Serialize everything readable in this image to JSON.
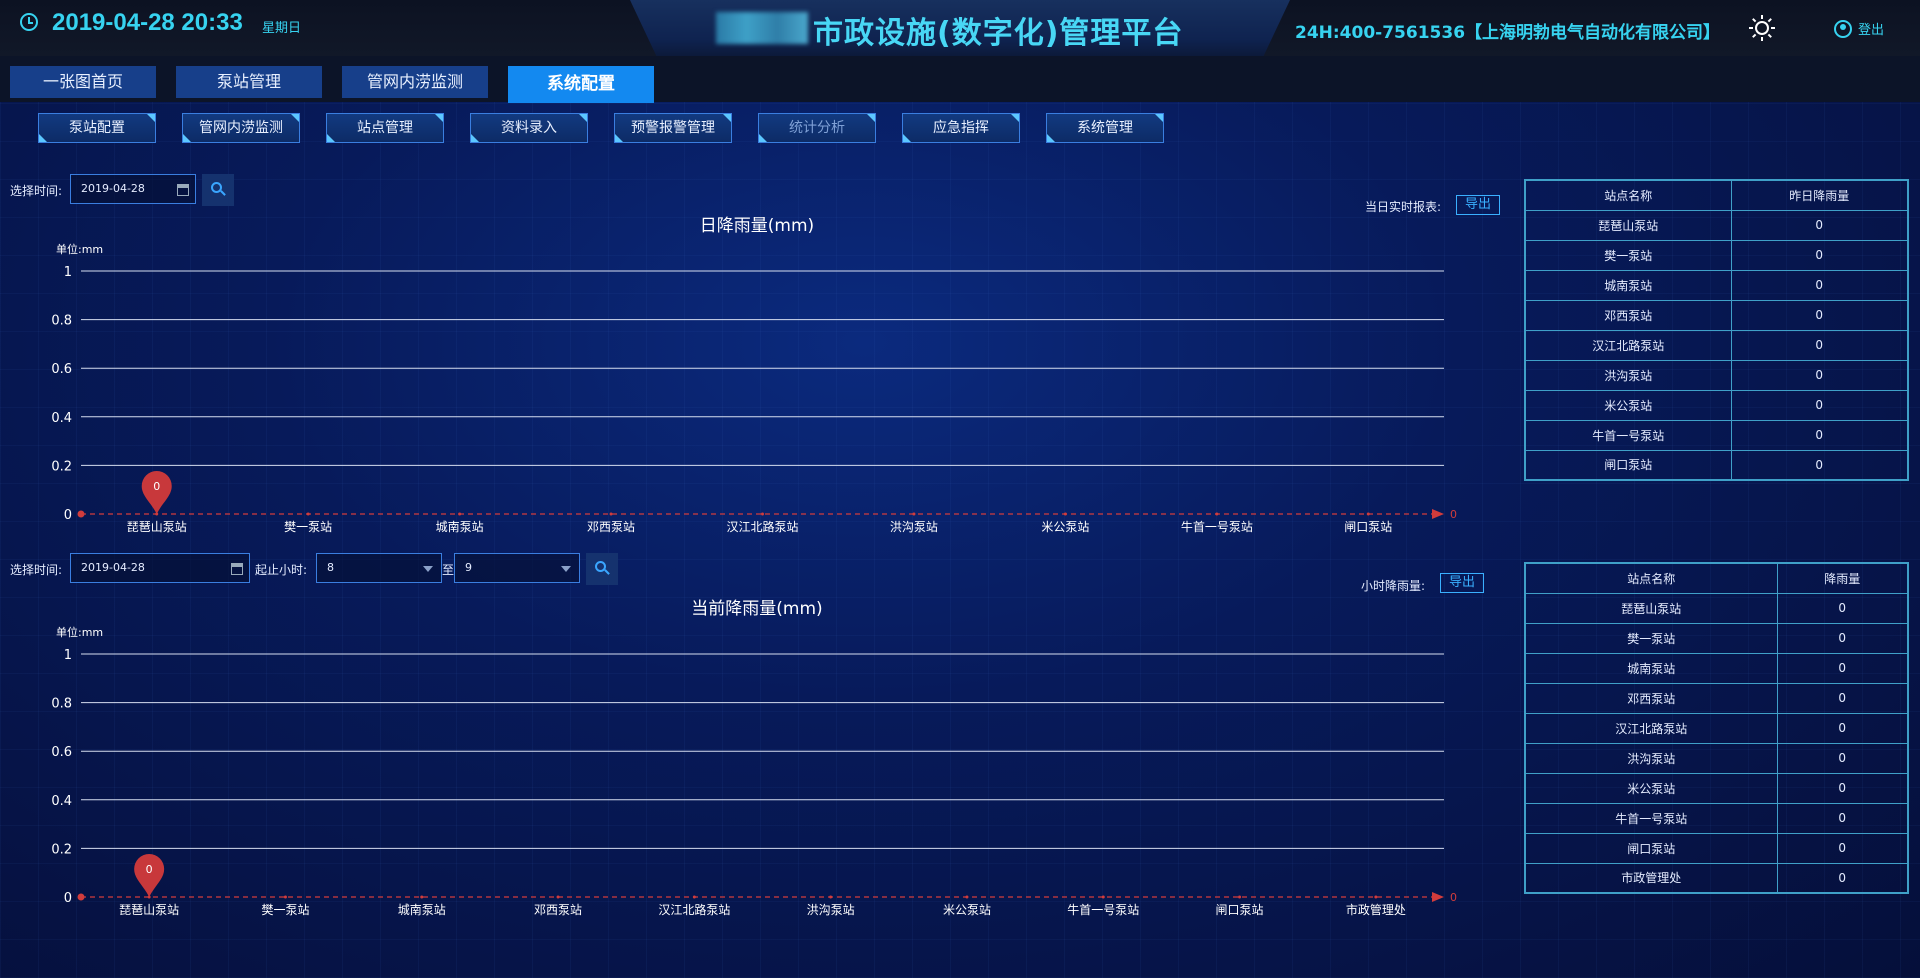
{
  "header": {
    "datetime": "2019-04-28 20:33",
    "weekday": "星期日",
    "app_title": "市政设施(数字化)管理平台",
    "hotline": "24H:400-7561536【上海明勃电气自动化有限公司】",
    "logout_label": "登出"
  },
  "main_tabs": [
    {
      "label": "一张图首页"
    },
    {
      "label": "泵站管理"
    },
    {
      "label": "管网内涝监测"
    },
    {
      "label": "系统配置",
      "active": true
    }
  ],
  "sub_tabs": [
    {
      "label": "泵站配置"
    },
    {
      "label": "管网内涝监测"
    },
    {
      "label": "站点管理"
    },
    {
      "label": "资料录入"
    },
    {
      "label": "预警报警管理"
    },
    {
      "label": "统计分析",
      "dim": true
    },
    {
      "label": "应急指挥"
    },
    {
      "label": "系统管理"
    }
  ],
  "daily": {
    "select_time_label": "选择时间:",
    "date_value": "2019-04-28",
    "report_label": "当日实时报表:",
    "export_label": "导出"
  },
  "hourly": {
    "select_time_label": "选择时间:",
    "date_value": "2019-04-28",
    "hour_label": "起止小时:",
    "hour_start": "8",
    "to_label": "至",
    "hour_end": "9",
    "report_label": "小时降雨量:",
    "export_label": "导出"
  },
  "chart_data": [
    {
      "type": "line",
      "title": "日降雨量(mm)",
      "unit_label": "单位:mm",
      "categories": [
        "琵琶山泵站",
        "樊一泵站",
        "城南泵站",
        "邓西泵站",
        "汉江北路泵站",
        "洪沟泵站",
        "米公泵站",
        "牛首一号泵站",
        "闸口泵站"
      ],
      "series": [
        {
          "values": [
            0,
            0,
            0,
            0,
            0,
            0,
            0,
            0,
            0
          ]
        }
      ],
      "ylim": [
        0,
        1
      ],
      "yticks": [
        "1",
        "0.8",
        "0.6",
        "0.4",
        "0.2",
        "0"
      ],
      "marker": {
        "category": "琵琶山泵站",
        "label": "0"
      },
      "end_label": "0",
      "grid": true
    },
    {
      "type": "line",
      "title": "当前降雨量(mm)",
      "unit_label": "单位:mm",
      "categories": [
        "琵琶山泵站",
        "樊一泵站",
        "城南泵站",
        "邓西泵站",
        "汉江北路泵站",
        "洪沟泵站",
        "米公泵站",
        "牛首一号泵站",
        "闸口泵站",
        "市政管理处"
      ],
      "series": [
        {
          "values": [
            0,
            0,
            0,
            0,
            0,
            0,
            0,
            0,
            0,
            0
          ]
        }
      ],
      "ylim": [
        0,
        1
      ],
      "yticks": [
        "1",
        "0.8",
        "0.6",
        "0.4",
        "0.2",
        "0"
      ],
      "marker": {
        "category": "琵琶山泵站",
        "label": "0"
      },
      "end_label": "0",
      "grid": true
    }
  ],
  "table_daily": {
    "headers": [
      "站点名称",
      "昨日降雨量"
    ],
    "rows": [
      [
        "琵琶山泵站",
        "0"
      ],
      [
        "樊一泵站",
        "0"
      ],
      [
        "城南泵站",
        "0"
      ],
      [
        "邓西泵站",
        "0"
      ],
      [
        "汉江北路泵站",
        "0"
      ],
      [
        "洪沟泵站",
        "0"
      ],
      [
        "米公泵站",
        "0"
      ],
      [
        "牛首一号泵站",
        "0"
      ],
      [
        "闸口泵站",
        "0"
      ]
    ]
  },
  "table_hourly": {
    "headers": [
      "站点名称",
      "降雨量"
    ],
    "rows": [
      [
        "琵琶山泵站",
        "0"
      ],
      [
        "樊一泵站",
        "0"
      ],
      [
        "城南泵站",
        "0"
      ],
      [
        "邓西泵站",
        "0"
      ],
      [
        "汉江北路泵站",
        "0"
      ],
      [
        "洪沟泵站",
        "0"
      ],
      [
        "米公泵站",
        "0"
      ],
      [
        "牛首一号泵站",
        "0"
      ],
      [
        "闸口泵站",
        "0"
      ],
      [
        "市政管理处",
        "0"
      ]
    ]
  }
}
